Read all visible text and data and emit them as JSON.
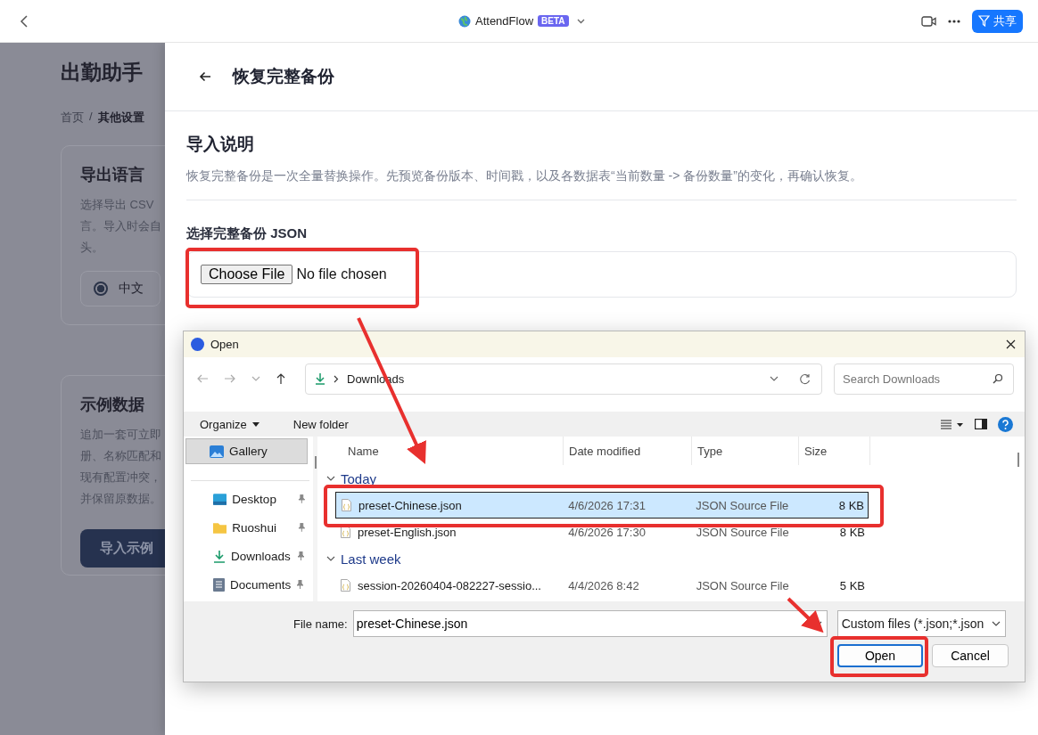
{
  "app_bar": {
    "title": "AttendFlow",
    "badge": "BETA",
    "share_button": "共享"
  },
  "page": {
    "title": "出勤助手",
    "breadcrumb": [
      {
        "label": "首页"
      },
      {
        "label": "其他设置"
      }
    ],
    "breadcrumb_separator": "/",
    "cards": [
      {
        "title": "导出语言",
        "lines": [
          "选择导出 CSV",
          "言。导入时会自",
          "头。"
        ],
        "options": [
          {
            "label": "中文",
            "selected": true
          }
        ]
      },
      {
        "title": "示例数据",
        "lines": [
          "追加一套可立即",
          "册、名称匹配和",
          "现有配置冲突，",
          "并保留原数据。"
        ],
        "button": "导入示例"
      }
    ]
  },
  "panel": {
    "title": "恢复完整备份",
    "section_title": "导入说明",
    "description": "恢复完整备份是一次全量替换操作。先预览备份版本、时间戳，以及各数据表“当前数量 -> 备份数量”的变化，再确认恢复。",
    "file_label": "选择完整备份 JSON",
    "choose_button": "Choose File",
    "file_status": "No file chosen"
  },
  "dialog": {
    "title": "Open",
    "path": "Downloads",
    "search_placeholder": "Search Downloads",
    "toolbar": [
      "Organize",
      "New folder"
    ],
    "nav": [
      {
        "label": "Gallery",
        "kind": "gallery",
        "selected": true,
        "pinned": false
      },
      {
        "label": "Desktop",
        "kind": "desktop",
        "selected": false,
        "pinned": true
      },
      {
        "label": "Ruoshui",
        "kind": "folder",
        "selected": false,
        "pinned": true
      },
      {
        "label": "Downloads",
        "kind": "downloads",
        "selected": false,
        "pinned": true
      },
      {
        "label": "Documents",
        "kind": "documents",
        "selected": false,
        "pinned": true
      }
    ],
    "columns": [
      "Name",
      "Date modified",
      "Type",
      "Size"
    ],
    "groups": [
      {
        "label": "Today",
        "files": [
          {
            "name": "preset-Chinese.json",
            "date": "4/6/2026 17:31",
            "type": "JSON Source File",
            "size": "8 KB",
            "selected": true
          },
          {
            "name": "preset-English.json",
            "date": "4/6/2026 17:30",
            "type": "JSON Source File",
            "size": "8 KB",
            "selected": false
          }
        ]
      },
      {
        "label": "Last week",
        "files": [
          {
            "name": "session-20260404-082227-sessio...",
            "date": "4/4/2026 8:42",
            "type": "JSON Source File",
            "size": "5 KB",
            "selected": false
          }
        ]
      }
    ],
    "file_name_label": "File name:",
    "file_name": "preset-Chinese.json",
    "filter": "Custom files (*.json;*.json",
    "buttons": [
      {
        "label": "Open",
        "default": true
      },
      {
        "label": "Cancel",
        "default": false
      }
    ]
  }
}
